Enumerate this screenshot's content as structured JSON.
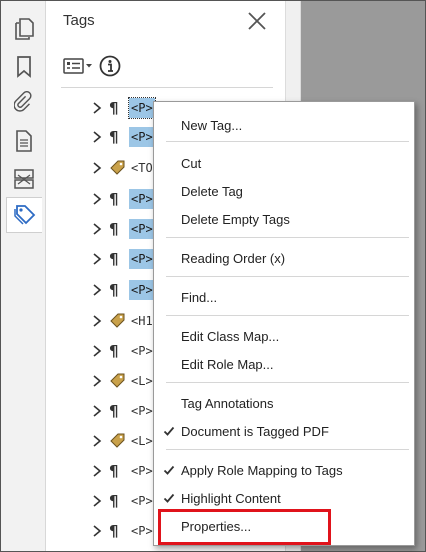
{
  "panel": {
    "title": "Tags",
    "close_icon": "close-icon",
    "options_icon": "tag-options-icon",
    "info_icon": "info-icon"
  },
  "left_toolbar": [
    {
      "name": "pages-tool",
      "icon": "pages-icon"
    },
    {
      "name": "bookmarks-tool",
      "icon": "bookmark-icon"
    },
    {
      "name": "attachments-tool",
      "icon": "paperclip-icon"
    },
    {
      "name": "content-tool",
      "icon": "document-icon"
    },
    {
      "name": "order-tool",
      "icon": "order-icon"
    },
    {
      "name": "tags-tool",
      "icon": "tag-icon",
      "active": true
    }
  ],
  "tree": [
    {
      "label": "<P>",
      "type": "paragraph",
      "highlight": true,
      "focused": true
    },
    {
      "label": "<P>",
      "type": "paragraph",
      "highlight": true
    },
    {
      "label": "<TO",
      "type": "tag",
      "highlight": false
    },
    {
      "label": "<P>",
      "type": "paragraph",
      "highlight": true
    },
    {
      "label": "<P>",
      "type": "paragraph",
      "highlight": true
    },
    {
      "label": "<P>",
      "type": "paragraph",
      "highlight": true
    },
    {
      "label": "<P>",
      "type": "paragraph",
      "highlight": true
    },
    {
      "label": "<H1",
      "type": "tag",
      "highlight": false
    },
    {
      "label": "<P>",
      "type": "paragraph",
      "highlight": false
    },
    {
      "label": "<L>",
      "type": "tag",
      "highlight": false
    },
    {
      "label": "<P>",
      "type": "paragraph",
      "highlight": false
    },
    {
      "label": "<L>",
      "type": "tag",
      "highlight": false
    },
    {
      "label": "<P>",
      "type": "paragraph",
      "highlight": false
    },
    {
      "label": "<P>",
      "type": "paragraph",
      "highlight": false
    },
    {
      "label": "<P>",
      "type": "paragraph",
      "highlight": false
    },
    {
      "label": "<P>",
      "type": "paragraph",
      "highlight": false
    }
  ],
  "context_menu": {
    "items": [
      {
        "label": "New Tag...",
        "checked": false
      },
      {
        "label": "Cut",
        "checked": false
      },
      {
        "label": "Delete Tag",
        "checked": false
      },
      {
        "label": "Delete Empty Tags",
        "checked": false
      },
      {
        "label": "Reading Order (x)",
        "checked": false
      },
      {
        "label": "Find...",
        "checked": false
      },
      {
        "label": "Edit Class Map...",
        "checked": false
      },
      {
        "label": "Edit Role Map...",
        "checked": false
      },
      {
        "label": "Tag Annotations",
        "checked": false
      },
      {
        "label": "Document is Tagged PDF",
        "checked": true
      },
      {
        "label": "Apply Role Mapping to Tags",
        "checked": true
      },
      {
        "label": "Highlight Content",
        "checked": true
      },
      {
        "label": "Properties...",
        "checked": false,
        "highlighted_by_callout": true
      }
    ]
  },
  "colors": {
    "selection": "#9cc6e6",
    "tag_icon": "#c9a14a",
    "accent": "#2d6bc4",
    "callout": "#e0131b"
  }
}
